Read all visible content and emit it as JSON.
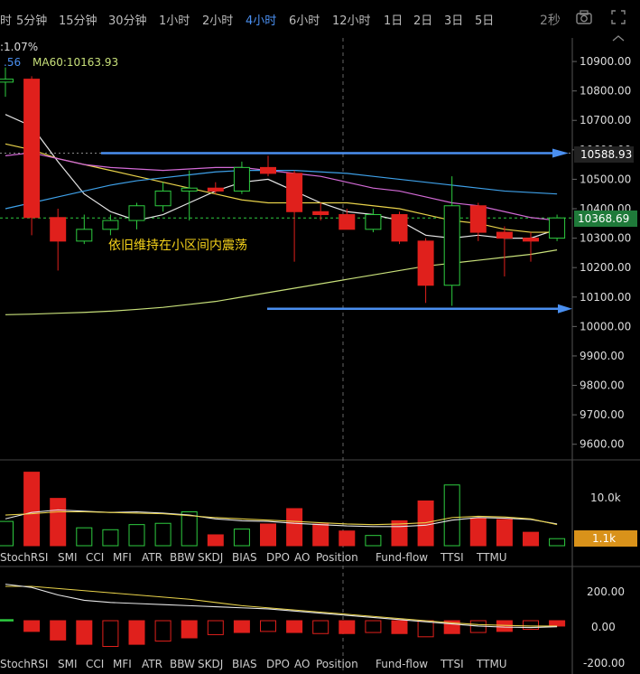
{
  "toolbar": {
    "timeframes": [
      "时",
      "5分钟",
      "15分钟",
      "30分钟",
      "1小时",
      "2小时",
      "4小时",
      "6小时",
      "12小时",
      "1日",
      "2日",
      "3日",
      "5日"
    ],
    "active_index": 6,
    "refresh": "2秒",
    "icons": [
      "camera-icon",
      "fullscreen-icon",
      "collapse-icon"
    ]
  },
  "info": {
    "change": ":1.07%",
    "ma_prefix": ".56",
    "ma60": "MA60:10163.93"
  },
  "annotation": "依旧维持在小区间内震荡",
  "price_labels": {
    "resistance": "10588.93",
    "current": "10368.69"
  },
  "volume_labels": {
    "top": "10.0k",
    "current": "1.1k"
  },
  "indicator_tabs": [
    "StochRSI",
    "SMI",
    "CCI",
    "MFI",
    "ATR",
    "BBW",
    "SKDJ",
    "BIAS",
    "DPO",
    "AO",
    "Position",
    "Fund-flow",
    "TTSI",
    "TTMU"
  ],
  "osc_ticks": [
    "200.00",
    "0.00",
    "-200.00"
  ],
  "colors": {
    "up": "#2ecc40",
    "down": "#e0201c",
    "accent": "#4a8ff0",
    "current_price": "#1f7a3a",
    "volume_current": "#d9921a"
  },
  "chart_data": {
    "type": "candlestick",
    "y_ticks": [
      10900,
      10800,
      10700,
      10600,
      10500,
      10400,
      10300,
      10200,
      10100,
      10000,
      9900,
      9800,
      9700,
      9600
    ],
    "ylim": [
      9550,
      10980
    ],
    "candles": [
      {
        "o": 10830,
        "h": 10880,
        "l": 10780,
        "c": 10840
      },
      {
        "o": 10840,
        "h": 10850,
        "l": 10310,
        "c": 10370
      },
      {
        "o": 10370,
        "h": 10400,
        "l": 10190,
        "c": 10290
      },
      {
        "o": 10290,
        "h": 10380,
        "l": 10280,
        "c": 10330
      },
      {
        "o": 10330,
        "h": 10380,
        "l": 10310,
        "c": 10360
      },
      {
        "o": 10360,
        "h": 10420,
        "l": 10330,
        "c": 10410
      },
      {
        "o": 10410,
        "h": 10490,
        "l": 10390,
        "c": 10460
      },
      {
        "o": 10460,
        "h": 10530,
        "l": 10360,
        "c": 10470
      },
      {
        "o": 10470,
        "h": 10490,
        "l": 10450,
        "c": 10460
      },
      {
        "o": 10460,
        "h": 10560,
        "l": 10450,
        "c": 10540
      },
      {
        "o": 10540,
        "h": 10580,
        "l": 10510,
        "c": 10520
      },
      {
        "o": 10520,
        "h": 10530,
        "l": 10220,
        "c": 10390
      },
      {
        "o": 10390,
        "h": 10420,
        "l": 10360,
        "c": 10380
      },
      {
        "o": 10380,
        "h": 10400,
        "l": 10330,
        "c": 10330
      },
      {
        "o": 10330,
        "h": 10400,
        "l": 10320,
        "c": 10380
      },
      {
        "o": 10380,
        "h": 10390,
        "l": 10280,
        "c": 10290
      },
      {
        "o": 10290,
        "h": 10300,
        "l": 10080,
        "c": 10140
      },
      {
        "o": 10140,
        "h": 10510,
        "l": 10070,
        "c": 10410
      },
      {
        "o": 10410,
        "h": 10420,
        "l": 10290,
        "c": 10320
      },
      {
        "o": 10320,
        "h": 10340,
        "l": 10170,
        "c": 10300
      },
      {
        "o": 10300,
        "h": 10320,
        "l": 10220,
        "c": 10290
      },
      {
        "o": 10300,
        "h": 10380,
        "l": 10290,
        "c": 10368.69
      }
    ],
    "ma_lines": [
      {
        "values": [
          10720,
          10680,
          10560,
          10450,
          10390,
          10360,
          10380,
          10420,
          10460,
          10490,
          10500,
          10460,
          10420,
          10390,
          10380,
          10360,
          10310,
          10300,
          10310,
          10300,
          10300,
          10330
        ],
        "color": "#e6e6e6"
      },
      {
        "values": [
          10620,
          10600,
          10570,
          10550,
          10530,
          10510,
          10490,
          10470,
          10450,
          10430,
          10420,
          10420,
          10420,
          10420,
          10410,
          10400,
          10380,
          10360,
          10350,
          10330,
          10320,
          10320
        ],
        "color": "#e8d24a"
      },
      {
        "values": [
          10580,
          10590,
          10570,
          10550,
          10540,
          10535,
          10530,
          10535,
          10540,
          10540,
          10530,
          10520,
          10510,
          10490,
          10470,
          10460,
          10440,
          10420,
          10410,
          10390,
          10370,
          10360
        ],
        "color": "#d36ad6"
      },
      {
        "values": [
          10400,
          10420,
          10440,
          10460,
          10480,
          10495,
          10505,
          10515,
          10525,
          10530,
          10530,
          10530,
          10525,
          10520,
          10510,
          10500,
          10490,
          10480,
          10470,
          10460,
          10455,
          10450
        ],
        "color": "#3ea0e8"
      },
      {
        "values": [
          10040,
          10042,
          10045,
          10048,
          10052,
          10058,
          10065,
          10075,
          10085,
          10100,
          10115,
          10130,
          10145,
          10160,
          10175,
          10190,
          10205,
          10215,
          10225,
          10235,
          10245,
          10260
        ],
        "color": "#c8e07a"
      }
    ],
    "reference_levels": [
      10588.93,
      10060
    ],
    "volume": {
      "ylim": [
        0,
        13000
      ],
      "bars": [
        {
          "v": 3800,
          "up": true
        },
        {
          "v": 11500,
          "up": false
        },
        {
          "v": 7400,
          "up": false
        },
        {
          "v": 2800,
          "up": true
        },
        {
          "v": 2500,
          "up": true
        },
        {
          "v": 3300,
          "up": true
        },
        {
          "v": 3500,
          "up": true
        },
        {
          "v": 5300,
          "up": true
        },
        {
          "v": 1700,
          "up": false
        },
        {
          "v": 2600,
          "up": true
        },
        {
          "v": 3400,
          "up": false
        },
        {
          "v": 5800,
          "up": false
        },
        {
          "v": 3400,
          "up": false
        },
        {
          "v": 2300,
          "up": false
        },
        {
          "v": 1600,
          "up": true
        },
        {
          "v": 3900,
          "up": false
        },
        {
          "v": 7000,
          "up": false
        },
        {
          "v": 9500,
          "up": true
        },
        {
          "v": 4300,
          "up": false
        },
        {
          "v": 4100,
          "up": false
        },
        {
          "v": 2100,
          "up": false
        },
        {
          "v": 1100,
          "up": true
        }
      ],
      "ma1": [
        4200,
        5200,
        5600,
        5400,
        5200,
        5300,
        5100,
        4800,
        4200,
        3900,
        3800,
        3500,
        3300,
        3100,
        3000,
        3000,
        3200,
        4000,
        4400,
        4300,
        4100,
        3400
      ],
      "ma2": [
        4800,
        5000,
        5300,
        5300,
        5200,
        5100,
        5000,
        4700,
        4400,
        4200,
        4000,
        3800,
        3600,
        3400,
        3300,
        3400,
        3600,
        4400,
        4600,
        4500,
        4200,
        3300
      ]
    },
    "oscillator": {
      "ylim": [
        -240,
        240
      ],
      "hist": [
        5,
        -50,
        -90,
        -110,
        -120,
        -110,
        -95,
        -80,
        -65,
        -55,
        -50,
        -55,
        -60,
        -60,
        -55,
        -60,
        -75,
        -60,
        -55,
        -50,
        -40,
        -25
      ],
      "line1": [
        160,
        160,
        150,
        140,
        130,
        120,
        110,
        100,
        85,
        70,
        60,
        50,
        40,
        30,
        20,
        10,
        0,
        -10,
        -18,
        -22,
        -25,
        -25
      ],
      "line2": [
        170,
        155,
        120,
        95,
        85,
        80,
        75,
        70,
        65,
        60,
        55,
        45,
        35,
        25,
        15,
        5,
        -5,
        -15,
        -25,
        -30,
        -32,
        -28
      ]
    }
  }
}
